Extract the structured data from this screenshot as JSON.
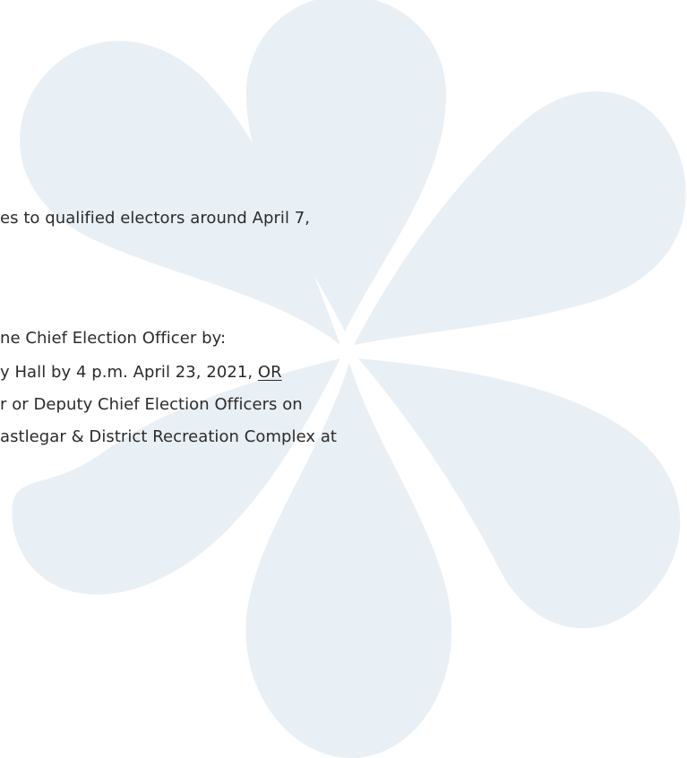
{
  "document": {
    "line1": "es to qualified electors around April 7,",
    "line2": "ne Chief Election Officer by:",
    "line3_text": "y Hall by 4 p.m. April 23, 2021, ",
    "line3_underlined": "OR",
    "line4": "r or Deputy Chief Election Officers on",
    "line5": "astlegar & District Recreation Complex at"
  },
  "watermark": {
    "shape": "five-petal-flower",
    "color": "#e8eff5"
  }
}
